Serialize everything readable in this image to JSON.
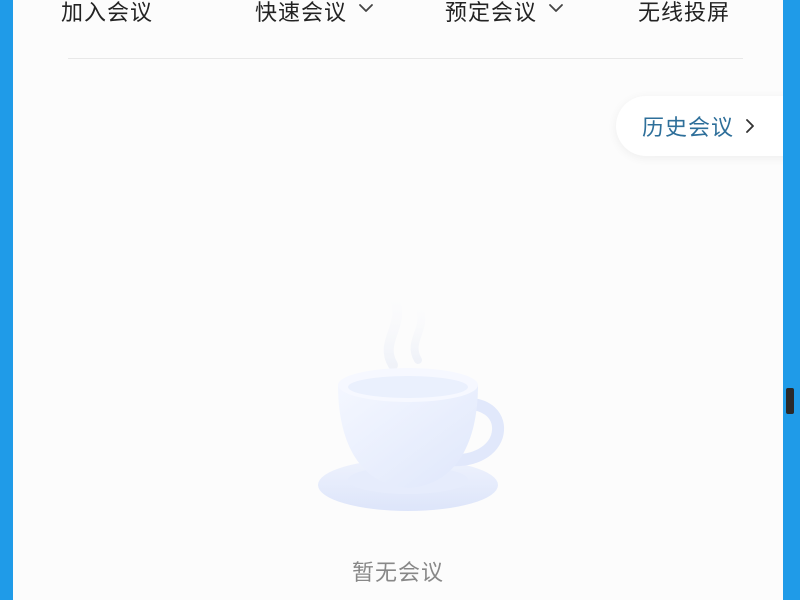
{
  "toolbar": {
    "join_meeting": "加入会议",
    "quick_meeting": "快速会议",
    "schedule_meeting": "预定会议",
    "wireless_projection": "无线投屏"
  },
  "history": {
    "label": "历史会议"
  },
  "empty_state": {
    "text": "暂无会议",
    "icon": "empty-cup-icon"
  },
  "colors": {
    "frame": "#1f9be8",
    "background": "#fcfcfc",
    "history_text": "#2e6f9a",
    "empty_text": "#888888",
    "cup": "#e3ebfd"
  }
}
